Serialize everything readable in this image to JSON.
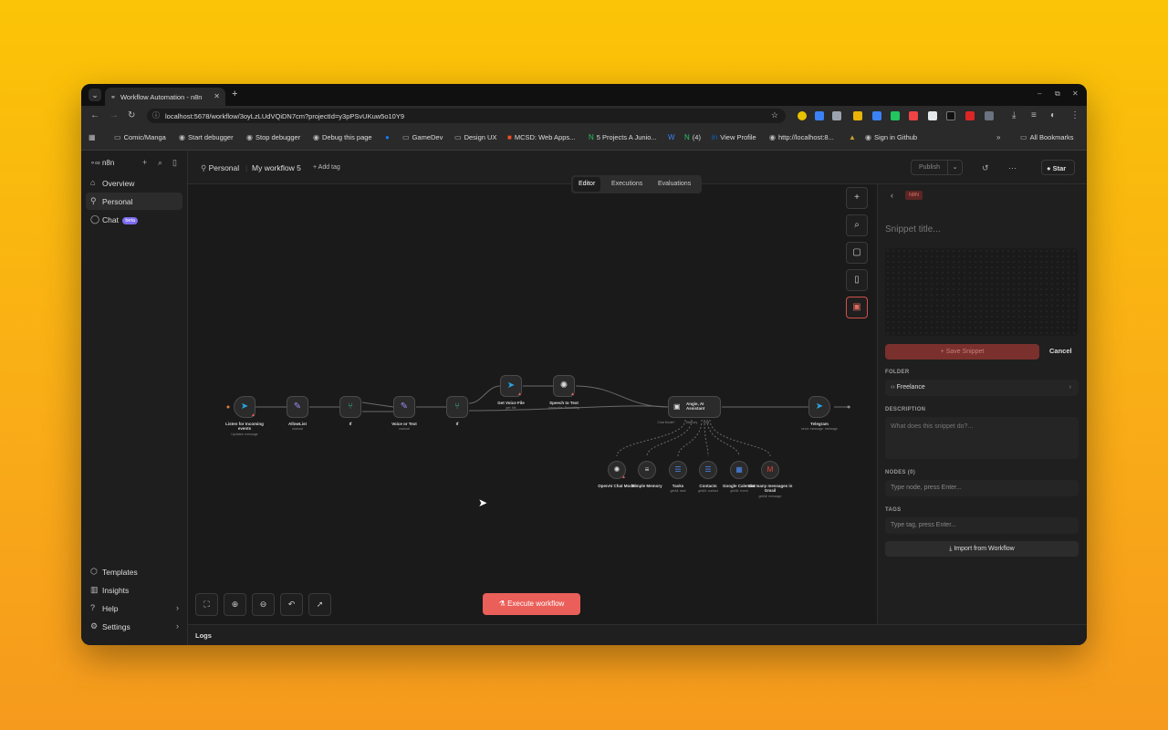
{
  "browser": {
    "tab_title": "Workflow Automation - n8n",
    "url": "localhost:5678/workflow/3oyLzLUdVQiDN7cm?projectId=y3pPSvUKuw5o10Y9",
    "bookmarks": [
      "Comic/Manga",
      "Start debugger",
      "Stop debugger",
      "Debug this page",
      "GameDev",
      "Design UX",
      "MCSD: Web Apps...",
      "5 Projects A Junio...",
      "(4)",
      "View Profile",
      "http://localhost:8...",
      "Sign in Github"
    ],
    "all_bookmarks": "All Bookmarks"
  },
  "sidebar": {
    "logo": "n8n",
    "top_items": [
      {
        "label": "Overview",
        "icon": "home-icon"
      },
      {
        "label": "Personal",
        "icon": "user-icon"
      },
      {
        "label": "Chat",
        "icon": "chat-icon",
        "badge": "beta"
      }
    ],
    "bottom_items": [
      {
        "label": "Templates",
        "icon": "box-icon"
      },
      {
        "label": "Insights",
        "icon": "chart-icon"
      },
      {
        "label": "Help",
        "icon": "help-icon"
      },
      {
        "label": "Settings",
        "icon": "gear-icon"
      }
    ]
  },
  "header": {
    "project": "Personal",
    "workflow_name": "My workflow 5",
    "add_tag": "+ Add tag",
    "publish": "Publish",
    "github": "Star"
  },
  "view_tabs": [
    "Editor",
    "Executions",
    "Evaluations"
  ],
  "nodes": [
    {
      "label": "Listen for Incoming events",
      "sub": "Updates: message"
    },
    {
      "label": "AllowList",
      "sub": "manual"
    },
    {
      "label": "If",
      "sub": ""
    },
    {
      "label": "Voice or Text",
      "sub": "manual"
    },
    {
      "label": "If",
      "sub": ""
    },
    {
      "label": "Get Voice File",
      "sub": "get: file"
    },
    {
      "label": "Speech to Text",
      "sub": "transcribe: Recording"
    },
    {
      "label": "Angie, AI Assistant",
      "sub": ""
    },
    {
      "label": "Telegram",
      "sub": "send: message: message"
    }
  ],
  "subnodes": [
    {
      "label": "OpenAI Chat Model",
      "sub": ""
    },
    {
      "label": "Simple Memory",
      "sub": ""
    },
    {
      "label": "Tasks",
      "sub": "getAll: task"
    },
    {
      "label": "Contacts",
      "sub": "getAll: contact"
    },
    {
      "label": "Google Calendar",
      "sub": "getAll: event"
    },
    {
      "label": "Get many messages in Gmail",
      "sub": "getAll: message"
    }
  ],
  "agent_ports": [
    "Chat Model*",
    "Memory",
    "Tool"
  ],
  "execute_button": "Execute workflow",
  "logs_label": "Logs",
  "snippet_panel": {
    "badge": "N8N",
    "title_placeholder": "Snippet title...",
    "save_button": "Save Snippet",
    "cancel_button": "Cancel",
    "folder_label": "FOLDER",
    "folder_value": "Freelance",
    "description_label": "DESCRIPTION",
    "description_placeholder": "What does this snippet do?...",
    "nodes_label": "NODES (0)",
    "nodes_placeholder": "Type node, press Enter...",
    "tags_label": "TAGS",
    "tags_placeholder": "Type tag, press Enter...",
    "import_button": "Import from Workflow"
  },
  "colors": {
    "accent": "#ea5f59",
    "telegram": "#2aa3e0",
    "panel_bg": "#1f1f1f"
  }
}
